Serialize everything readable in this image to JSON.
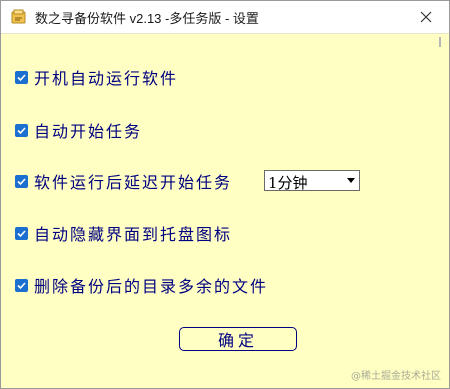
{
  "window": {
    "title": "数之寻备份软件 v2.13 -多任务版 - 设置",
    "close_icon": "close-icon",
    "app_icon": "app-logo-icon"
  },
  "options": [
    {
      "label": "开机自动运行软件",
      "checked": true
    },
    {
      "label": "自动开始任务",
      "checked": true
    },
    {
      "label": "软件运行后延迟开始任务",
      "checked": true
    },
    {
      "label": "自动隐藏界面到托盘图标",
      "checked": true
    },
    {
      "label": "删除备份后的目录多余的文件",
      "checked": true
    }
  ],
  "delay_select": {
    "value": "1分钟"
  },
  "ok_button": {
    "label": "确定"
  },
  "watermark": "@稀土掘金技术社区",
  "colors": {
    "background": "#ffffc4",
    "text": "#000080",
    "checkbox": "#1a6fd0"
  }
}
